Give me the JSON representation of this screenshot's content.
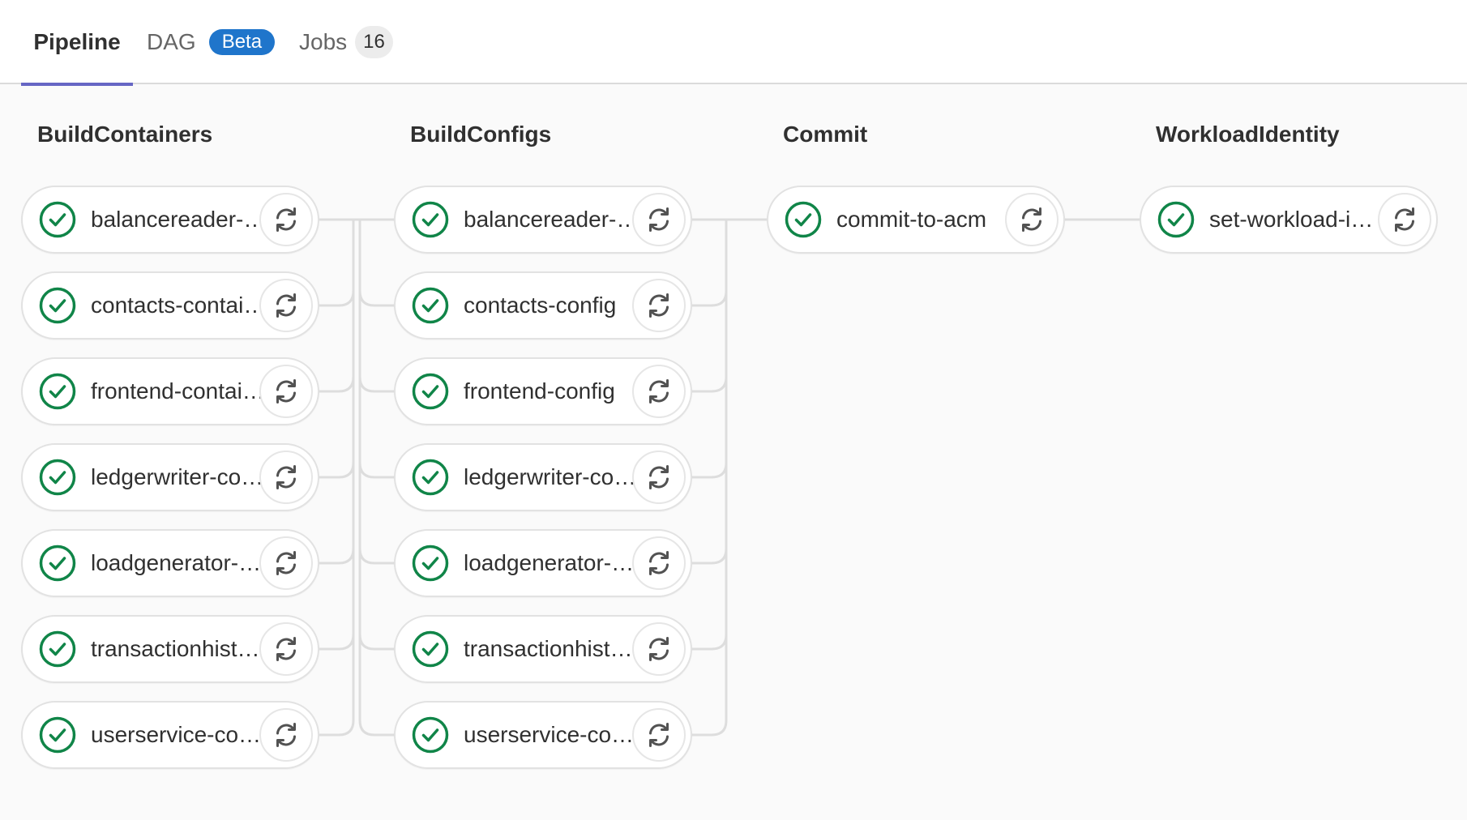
{
  "tabs": {
    "pipeline": "Pipeline",
    "dag": "DAG",
    "dag_badge": "Beta",
    "jobs": "Jobs",
    "jobs_count": "16"
  },
  "stages": [
    {
      "title": "BuildContainers",
      "jobs": [
        {
          "name": "balancereader-…",
          "status": "success"
        },
        {
          "name": "contacts-contai…",
          "status": "success"
        },
        {
          "name": "frontend-contai…",
          "status": "success"
        },
        {
          "name": "ledgerwriter-co…",
          "status": "success"
        },
        {
          "name": "loadgenerator-…",
          "status": "success"
        },
        {
          "name": "transactionhisto…",
          "status": "success"
        },
        {
          "name": "userservice-co…",
          "status": "success"
        }
      ]
    },
    {
      "title": "BuildConfigs",
      "jobs": [
        {
          "name": "balancereader-…",
          "status": "success"
        },
        {
          "name": "contacts-config",
          "status": "success"
        },
        {
          "name": "frontend-config",
          "status": "success"
        },
        {
          "name": "ledgerwriter-co…",
          "status": "success"
        },
        {
          "name": "loadgenerator-…",
          "status": "success"
        },
        {
          "name": "transactionhisto…",
          "status": "success"
        },
        {
          "name": "userservice-co…",
          "status": "success"
        }
      ]
    },
    {
      "title": "Commit",
      "jobs": [
        {
          "name": "commit-to-acm",
          "status": "success"
        }
      ]
    },
    {
      "title": "WorkloadIdentity",
      "jobs": [
        {
          "name": "set-workload-i…",
          "status": "success"
        }
      ]
    }
  ],
  "colors": {
    "success": "#108548",
    "tab_underline": "#6666c4",
    "beta_badge": "#1f75cb",
    "connector": "#dddddd"
  },
  "icons": {
    "status": "check-circle-icon",
    "retry": "retry-icon"
  }
}
